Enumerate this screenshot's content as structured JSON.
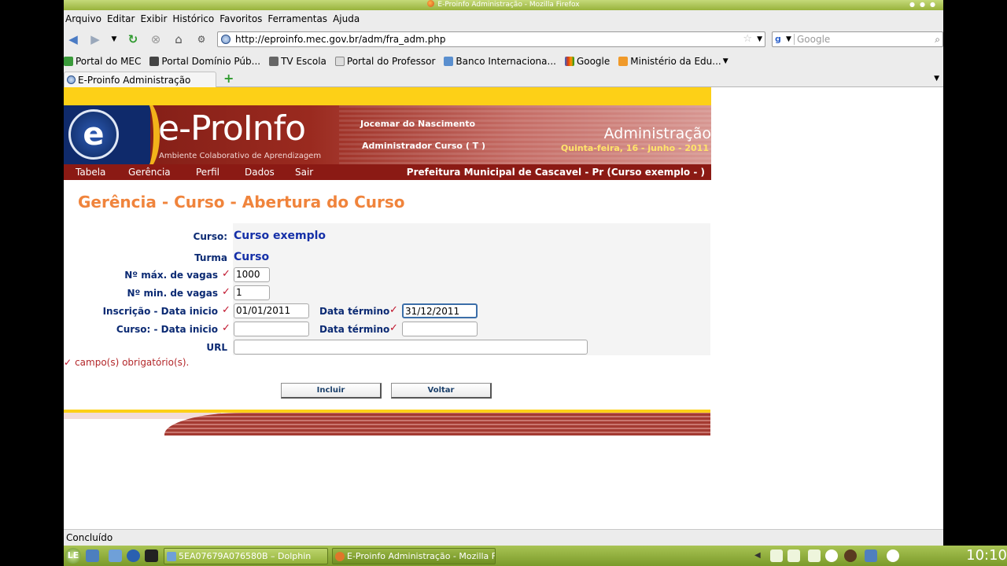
{
  "window": {
    "title": "E-Proinfo Administração - Mozilla Firefox"
  },
  "menu": [
    "Arquivo",
    "Editar",
    "Exibir",
    "Histórico",
    "Favoritos",
    "Ferramentas",
    "Ajuda"
  ],
  "navigation": {
    "url": "http://eproinfo.mec.gov.br/adm/fra_adm.php",
    "search_placeholder": "Google"
  },
  "bookmarks": [
    "Portal do MEC",
    "Portal Domínio Púb...",
    "TV Escola",
    "Portal do Professor",
    "Banco Internaciona...",
    "Google",
    "Ministério da Edu..."
  ],
  "tab": {
    "title": "E-Proinfo Administração"
  },
  "banner": {
    "brand": "e-ProInfo",
    "tagline": "Ambiente Colaborativo de Aprendizagem",
    "user": "Jocemar do Nascimento",
    "role": "Administrador Curso ( T )",
    "section": "Administração",
    "date": "Quinta-feira, 16 - junho - 2011"
  },
  "site_nav": {
    "items": [
      "Tabela",
      "Gerência",
      "Perfil",
      "Dados",
      "Sair"
    ],
    "institution": "Prefeitura Municipal de Cascavel - Pr (Curso exemplo - )"
  },
  "page": {
    "title": "Gerência - Curso - Abertura do Curso"
  },
  "form": {
    "curso_label": "Curso:",
    "curso_value": "Curso exemplo",
    "turma_label": "Turma",
    "turma_value": "Curso",
    "max_vagas_label": "Nº máx. de vagas",
    "max_vagas_value": "1000",
    "min_vagas_label": "Nº min. de vagas",
    "min_vagas_value": "1",
    "insc_inicio_label": "Inscrição - Data inicio",
    "insc_inicio_value": "01/01/2011",
    "insc_termino_label": "Data término",
    "insc_termino_value": "31/12/2011",
    "curso_inicio_label": "Curso: - Data inicio",
    "curso_inicio_value": "",
    "curso_termino_label": "Data término",
    "curso_termino_value": "",
    "url_label": "URL",
    "url_value": "",
    "required_mark": "✓",
    "required_note": "campo(s) obrigatório(s).",
    "include_label": "Incluir",
    "back_label": "Voltar"
  },
  "status": {
    "text": "Concluído"
  },
  "taskbar": {
    "tasks": [
      "5EA07679A076580B – Dolphin",
      "E-Proinfo Administração - Mozilla Firefo"
    ],
    "clock": "10:10"
  }
}
